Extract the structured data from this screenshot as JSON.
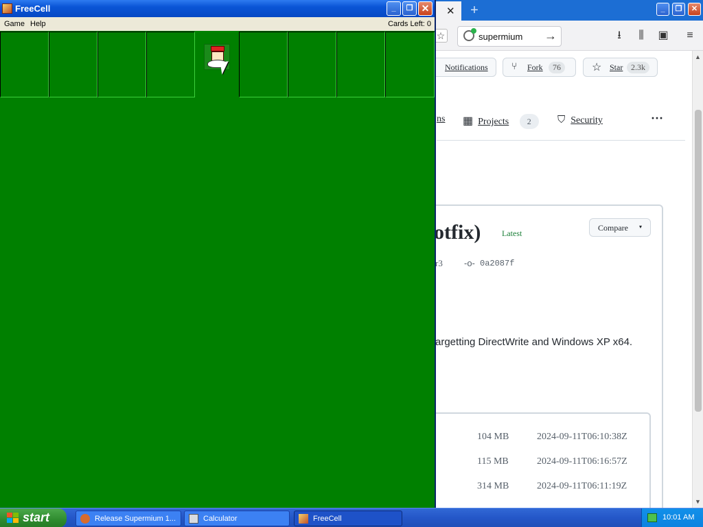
{
  "browser": {
    "tab": {
      "close_glyph": "✕"
    },
    "new_tab_glyph": "+",
    "window_controls": {
      "minimize": "_",
      "restore": "❐",
      "close": "✕"
    },
    "url": "supermium",
    "url_go_glyph": "→",
    "toolbar_icons": [
      "download-icon",
      "library-icon",
      "sidebar-icon",
      "menu-icon"
    ],
    "toolbar_glyphs": {
      "download": "⭳",
      "library": "⫼",
      "sidebar": "▣",
      "menu": "≡",
      "bookmark": "☆"
    },
    "repo_buttons": {
      "notifications": {
        "label": "Notifications",
        "icon": "bell-icon"
      },
      "fork": {
        "label": "Fork",
        "count": "76",
        "icon": "fork-icon",
        "glyph": "⑂"
      },
      "star": {
        "label": "Star",
        "count": "2.3k",
        "icon": "star-icon",
        "glyph": "☆"
      }
    },
    "nav": {
      "partial": "ns",
      "projects": {
        "label": "Projects",
        "count": "2",
        "glyph": "▦"
      },
      "security": {
        "label": "Security",
        "glyph": "⛉"
      },
      "more": "···"
    },
    "release": {
      "title_fragment": "otfix)",
      "latest_label": "Latest",
      "compare_label": "Compare",
      "compare_caret": "▾",
      "tag_fragment": "r3",
      "commit_glyph": "-o-",
      "commit": "0a2087f",
      "description_fragment": "argetting DirectWrite and Windows XP x64."
    },
    "assets": [
      {
        "size": "104 MB",
        "date": "2024-09-11T06:10:38Z"
      },
      {
        "size": "115 MB",
        "date": "2024-09-11T06:16:57Z"
      },
      {
        "size": "314 MB",
        "date": "2024-09-11T06:11:19Z"
      }
    ],
    "scroll_arrows": {
      "up": "▲",
      "down": "▼"
    }
  },
  "freecell": {
    "title": "FreeCell",
    "controls": {
      "minimize": "_",
      "restore": "❐",
      "close": "✕"
    },
    "menu": [
      "Game",
      "Help"
    ],
    "cards_left_label": "Cards Left:",
    "cards_left_value": "0"
  },
  "taskbar": {
    "start_label": "start",
    "tasks": [
      {
        "label": "Release Supermium 1...",
        "active": false
      },
      {
        "label": "Calculator",
        "active": false
      },
      {
        "label": "FreeCell",
        "active": true
      }
    ],
    "clock": "10:01 AM"
  },
  "colors": {
    "felt": "#008000",
    "xp_blue": "#0a55d6",
    "start_green": "#2e8b2e",
    "github_latest_green": "#1a7f37"
  }
}
